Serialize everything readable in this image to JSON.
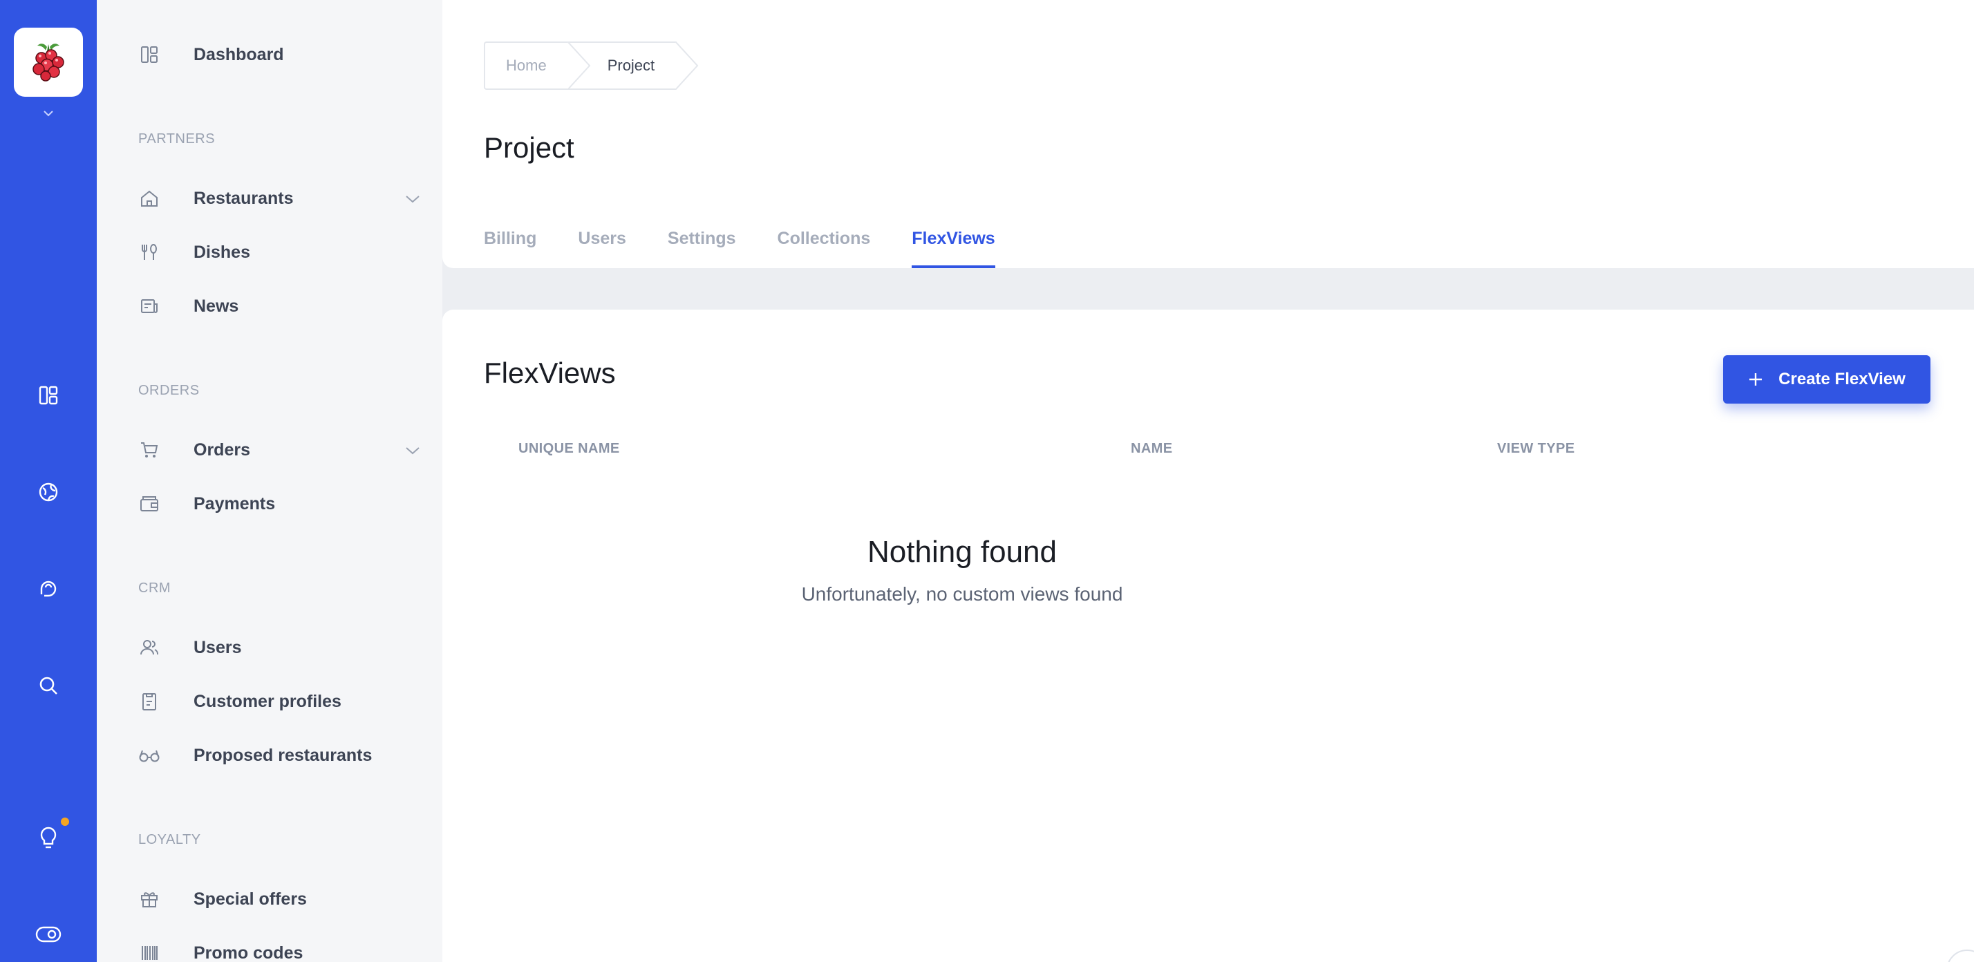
{
  "colors": {
    "brand": "#3155e3",
    "notification_dot": "#f5a623",
    "sidebar_bg": "#f5f6f8"
  },
  "rail": {
    "logo": "raspberry-logo",
    "icons": [
      "dashboard-icon",
      "globe-icon",
      "chat-icon",
      "search-icon",
      "lightbulb-icon",
      "toggle-icon"
    ]
  },
  "sidebar": {
    "dashboard": "Dashboard",
    "sections": {
      "partners": "PARTNERS",
      "orders": "ORDERS",
      "crm": "CRM",
      "loyalty": "LOYALTY"
    },
    "items": {
      "restaurants": "Restaurants",
      "dishes": "Dishes",
      "news": "News",
      "orders": "Orders",
      "payments": "Payments",
      "users": "Users",
      "customer_profiles": "Customer profiles",
      "proposed_restaurants": "Proposed restaurants",
      "special_offers": "Special offers",
      "promo_codes": "Promo codes"
    }
  },
  "header": {
    "breadcrumb": [
      "Home",
      "Project"
    ],
    "title": "Project",
    "tabs": [
      "Billing",
      "Users",
      "Settings",
      "Collections",
      "FlexViews"
    ],
    "active_tab": "FlexViews"
  },
  "main": {
    "title": "FlexViews",
    "create_button": "Create FlexView",
    "columns": [
      "UNIQUE NAME",
      "NAME",
      "VIEW TYPE"
    ],
    "empty_title": "Nothing found",
    "empty_subtitle": "Unfortunately, no custom views found"
  }
}
